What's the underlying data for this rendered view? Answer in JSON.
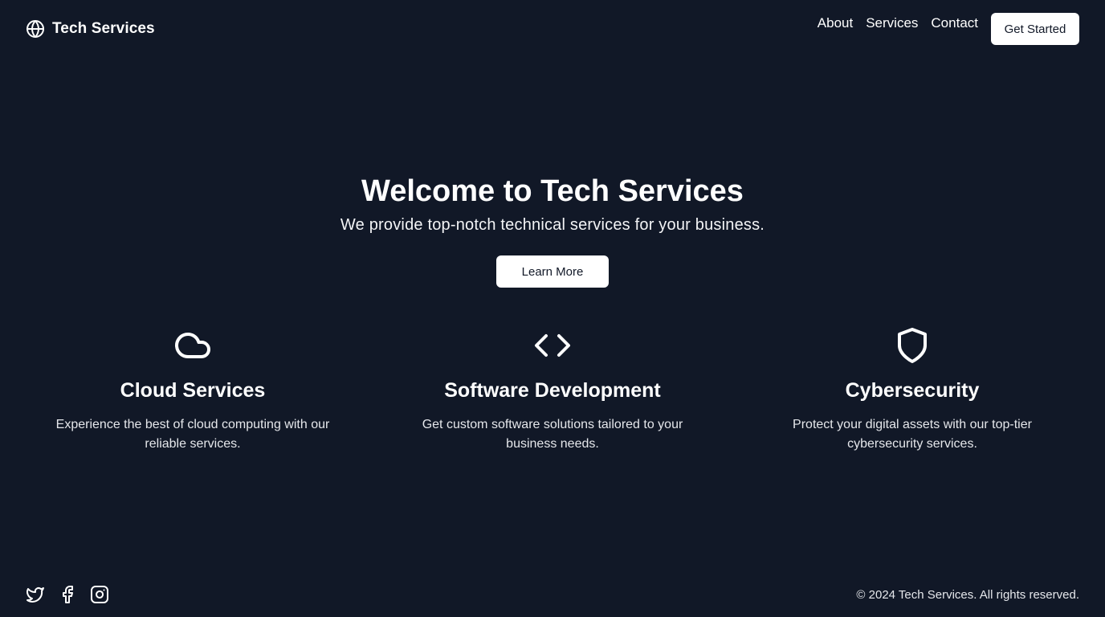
{
  "header": {
    "brand": {
      "icon": "globe-icon",
      "name": "Tech Services"
    },
    "nav": [
      {
        "label": "About"
      },
      {
        "label": "Services"
      },
      {
        "label": "Contact"
      }
    ],
    "cta_label": "Get Started"
  },
  "hero": {
    "title": "Welcome to Tech Services",
    "subtitle": "We provide top-notch technical services for your business.",
    "button_label": "Learn More"
  },
  "features": [
    {
      "icon": "cloud-icon",
      "title": "Cloud Services",
      "description": "Experience the best of cloud computing with our reliable services."
    },
    {
      "icon": "code-icon",
      "title": "Software Development",
      "description": "Get custom software solutions tailored to your business needs."
    },
    {
      "icon": "shield-icon",
      "title": "Cybersecurity",
      "description": "Protect your digital assets with our top-tier cybersecurity services."
    }
  ],
  "footer": {
    "social": [
      {
        "icon": "twitter-icon"
      },
      {
        "icon": "facebook-icon"
      },
      {
        "icon": "instagram-icon"
      }
    ],
    "copyright": "© 2024 Tech Services. All rights reserved."
  },
  "colors": {
    "background": "#111827",
    "text": "#ffffff",
    "button_bg": "#ffffff",
    "button_text": "#111827"
  }
}
